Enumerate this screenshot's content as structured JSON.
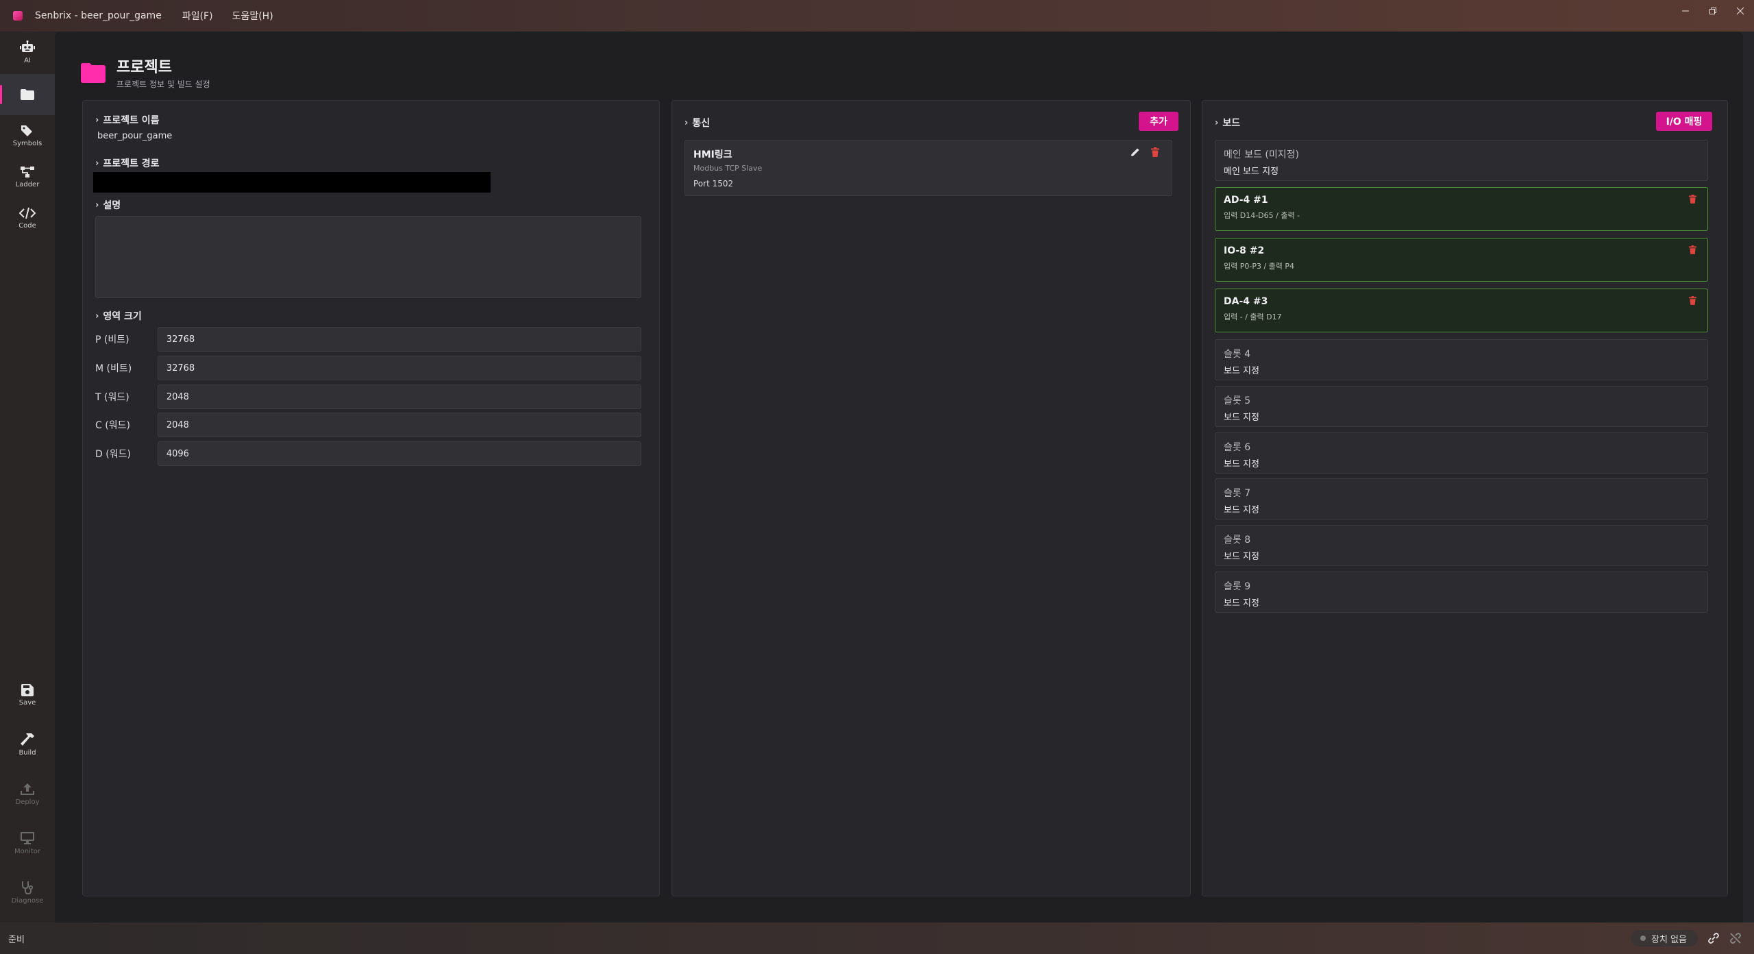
{
  "window": {
    "title": "Senbrix - beer_pour_game",
    "menu": [
      "파일(F)",
      "도움말(H)"
    ]
  },
  "rail": {
    "items": [
      {
        "label": "AI",
        "icon": "robot-icon"
      },
      {
        "label": "",
        "icon": "folder-icon"
      },
      {
        "label": "Symbols",
        "icon": "tag-icon"
      },
      {
        "label": "Ladder",
        "icon": "ladder-icon"
      },
      {
        "label": "Code",
        "icon": "code-icon"
      },
      {
        "label": "Save",
        "icon": "save-icon"
      },
      {
        "label": "Build",
        "icon": "hammer-icon"
      },
      {
        "label": "Deploy",
        "icon": "upload-icon"
      },
      {
        "label": "Monitor",
        "icon": "monitor-icon"
      },
      {
        "label": "Diagnose",
        "icon": "stethoscope-icon"
      }
    ]
  },
  "page": {
    "title": "프로젝트",
    "subtitle": "프로젝트 정보 및 빌드 설정"
  },
  "project": {
    "name_heading": "프로젝트 이름",
    "name_value": "beer_pour_game",
    "path_heading": "프로젝트 경로",
    "desc_heading": "설명",
    "memory_heading": "영역 크기",
    "memory": [
      {
        "label": "P (비트)",
        "value": "32768"
      },
      {
        "label": "M (비트)",
        "value": "32768"
      },
      {
        "label": "T (워드)",
        "value": "2048"
      },
      {
        "label": "C (워드)",
        "value": "2048"
      },
      {
        "label": "D (워드)",
        "value": "4096"
      }
    ]
  },
  "comm": {
    "heading": "통신",
    "add_label": "추가",
    "cards": [
      {
        "title": "HMI링크",
        "protocol": "Modbus TCP Slave",
        "detail": "Port 1502"
      }
    ]
  },
  "board": {
    "heading": "보드",
    "io_map_label": "I/O 매핑",
    "slots": [
      {
        "name": "메인 보드 (미지정)",
        "detail": "메인 보드 지정",
        "assigned": false
      },
      {
        "name": "AD-4 #1",
        "detail": "입력 D14-D65 / 출력 -",
        "assigned": true
      },
      {
        "name": "IO-8 #2",
        "detail": "입력 P0-P3 / 출력 P4",
        "assigned": true
      },
      {
        "name": "DA-4 #3",
        "detail": "입력 - / 출력 D17",
        "assigned": true
      },
      {
        "name": "슬롯 4",
        "detail": "보드 지정",
        "assigned": false
      },
      {
        "name": "슬롯 5",
        "detail": "보드 지정",
        "assigned": false
      },
      {
        "name": "슬롯 6",
        "detail": "보드 지정",
        "assigned": false
      },
      {
        "name": "슬롯 7",
        "detail": "보드 지정",
        "assigned": false
      },
      {
        "name": "슬롯 8",
        "detail": "보드 지정",
        "assigned": false
      },
      {
        "name": "슬롯 9",
        "detail": "보드 지정",
        "assigned": false
      }
    ]
  },
  "status": {
    "left_text": "준비",
    "device_text": "장치 없음"
  },
  "colors": {
    "accent": "#d4148c",
    "folder": "#ff2dac",
    "assigned_border": "#4d8f3a",
    "trash": "#e0443e"
  }
}
